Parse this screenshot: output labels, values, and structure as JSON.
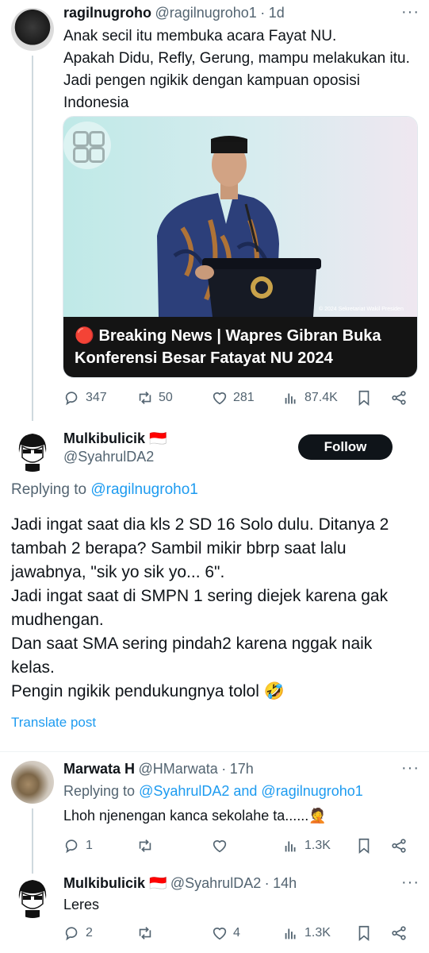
{
  "tweet1": {
    "name": "ragilnugroho",
    "handle": "@ragilnugroho1",
    "time": "1d",
    "text": "Anak secil itu membuka acara Fayat NU.\nApakah Didu, Refly, Gerung, mampu melakukan itu. Jadi pengen ngikik dengan kampuan oposisi Indonesia",
    "media_caption": "🔴 Breaking News | Wapres Gibran Buka Konferensi Besar Fatayat NU 2024",
    "media_watermark": "© 2024 Sekretariat Wakil Presiden",
    "actions": {
      "replies": "347",
      "retweets": "50",
      "likes": "281",
      "views": "87.4K"
    }
  },
  "tweet2": {
    "name": "Mulkibulicik 🇮🇩",
    "handle": "@SyahrulDA2",
    "follow_label": "Follow",
    "replying_prefix": "Replying to ",
    "replying_to": "@ragilnugroho1",
    "text": "Jadi ingat saat dia kls 2 SD 16 Solo dulu. Ditanya 2 tambah 2 berapa? Sambil mikir bbrp saat lalu jawabnya, \"sik yo sik yo... 6\".\nJadi ingat saat di SMPN 1 sering diejek karena gak mudhengan.\nDan saat SMA sering pindah2 karena nggak naik kelas.\nPengin ngikik pendukungnya tolol 🤣",
    "translate": "Translate post"
  },
  "tweet3": {
    "name": "Marwata H",
    "handle": "@HMarwata",
    "time": "17h",
    "replying_prefix": "Replying to ",
    "replying_to": "@SyahrulDA2 and @ragilnugroho1",
    "text": "Lhoh njenengan kanca sekolahe ta......🤦",
    "actions": {
      "replies": "1",
      "retweets": "",
      "likes": "",
      "views": "1.3K"
    }
  },
  "tweet4": {
    "name": "Mulkibulicik 🇮🇩",
    "handle": "@SyahrulDA2",
    "time": "14h",
    "text": "Leres",
    "actions": {
      "replies": "2",
      "retweets": "",
      "likes": "4",
      "views": "1.3K"
    }
  },
  "icons": {
    "reply": "reply-icon",
    "retweet": "retweet-icon",
    "like": "heart-icon",
    "views": "views-icon",
    "bookmark": "bookmark-icon",
    "share": "share-icon",
    "more": "more-icon"
  },
  "colors": {
    "link": "#1d9bf0",
    "muted": "#536471",
    "text": "#0f1419",
    "follow_bg": "#0f1419"
  }
}
